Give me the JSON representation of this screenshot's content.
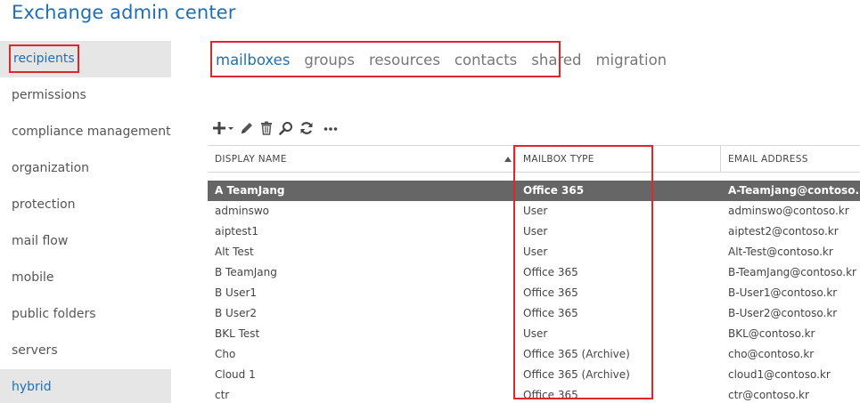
{
  "app": {
    "title": "Exchange admin center"
  },
  "sidebar": {
    "items": [
      {
        "label": "recipients"
      },
      {
        "label": "permissions"
      },
      {
        "label": "compliance management"
      },
      {
        "label": "organization"
      },
      {
        "label": "protection"
      },
      {
        "label": "mail flow"
      },
      {
        "label": "mobile"
      },
      {
        "label": "public folders"
      },
      {
        "label": "servers"
      },
      {
        "label": "hybrid"
      }
    ]
  },
  "tabs": [
    {
      "label": "mailboxes"
    },
    {
      "label": "groups"
    },
    {
      "label": "resources"
    },
    {
      "label": "contacts"
    },
    {
      "label": "shared"
    },
    {
      "label": "migration"
    }
  ],
  "toolbar": {
    "icons": [
      "add-icon",
      "edit-icon",
      "delete-icon",
      "search-icon",
      "refresh-icon",
      "more-icon"
    ]
  },
  "table": {
    "columns": [
      "DISPLAY NAME",
      "MAILBOX TYPE",
      "EMAIL ADDRESS"
    ],
    "rows": [
      {
        "name": "A TeamJang",
        "type": "Office 365",
        "email": "A-Teamjang@contoso.kr"
      },
      {
        "name": "adminswo",
        "type": "User",
        "email": "adminswo@contoso.kr"
      },
      {
        "name": "aiptest1",
        "type": "User",
        "email": "aiptest2@contoso.kr"
      },
      {
        "name": "Alt Test",
        "type": "User",
        "email": "Alt-Test@contoso.kr"
      },
      {
        "name": "B TeamJang",
        "type": "Office 365",
        "email": "B-TeamJang@contoso.kr"
      },
      {
        "name": "B User1",
        "type": "Office 365",
        "email": "B-User1@contoso.kr"
      },
      {
        "name": "B User2",
        "type": "Office 365",
        "email": "B-User2@contoso.kr"
      },
      {
        "name": "BKL Test",
        "type": "User",
        "email": "BKL@contoso.kr"
      },
      {
        "name": "Cho",
        "type": "Office 365 (Archive)",
        "email": "cho@contoso.kr"
      },
      {
        "name": "Cloud 1",
        "type": "Office 365 (Archive)",
        "email": "cloud1@contoso.kr"
      },
      {
        "name": "ctr",
        "type": "Office 365",
        "email": "ctr@contoso.kr"
      }
    ]
  },
  "colors": {
    "accent": "#1f6fb5",
    "highlight_outline": "#e0262d",
    "selected_row": "#666666"
  }
}
